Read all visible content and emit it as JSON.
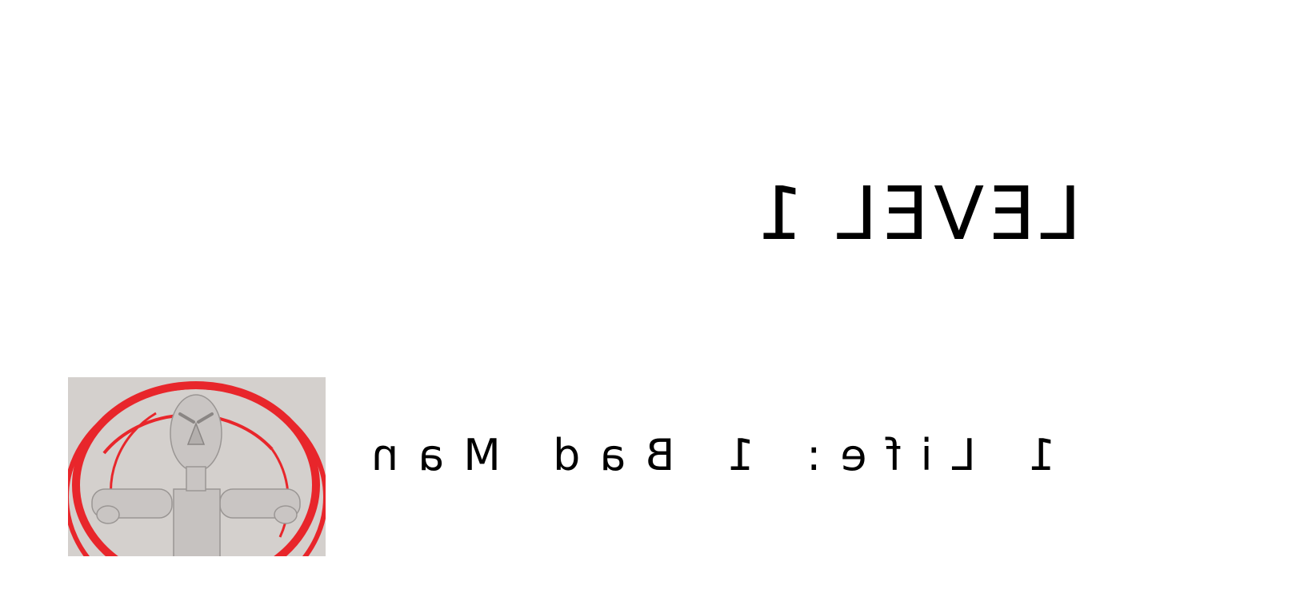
{
  "level": {
    "title": "LEVEL 1"
  },
  "info": {
    "text": "1 Life: 1 Bad Man"
  },
  "portrait": {
    "subject": "bad-man-enemy",
    "background_color": "#d4d0cd",
    "ring_color": "#e8262b",
    "figure_color": "#c9c5c3"
  },
  "colors": {
    "background": "#ffffff",
    "text": "#000000"
  }
}
